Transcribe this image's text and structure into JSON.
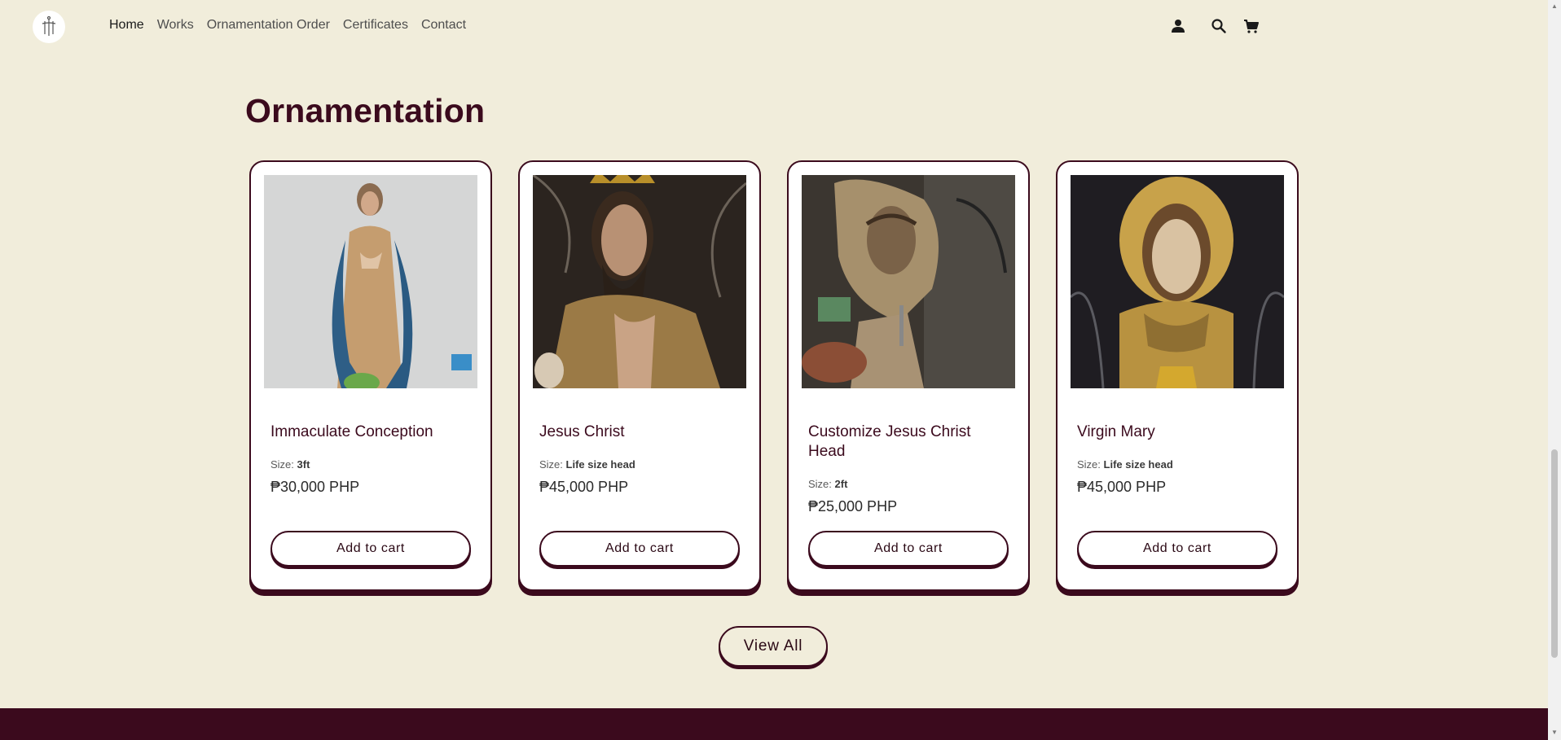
{
  "header": {
    "nav": [
      {
        "label": "Home",
        "active": true
      },
      {
        "label": "Works"
      },
      {
        "label": "Ornamentation Order"
      },
      {
        "label": "Certificates"
      },
      {
        "label": "Contact"
      }
    ],
    "icons": [
      "account-icon",
      "search-icon",
      "cart-icon"
    ]
  },
  "section": {
    "title": "Ornamentation",
    "view_all_label": "View All"
  },
  "products": [
    {
      "title": "Immaculate Conception",
      "size_label": "Size: ",
      "size_value": "3ft",
      "price": "₱30,000 PHP",
      "button": "Add to cart"
    },
    {
      "title": "Jesus Christ",
      "size_label": "Size: ",
      "size_value": "Life size head",
      "price": "₱45,000 PHP",
      "button": "Add to cart"
    },
    {
      "title": "Customize Jesus Christ Head",
      "size_label": "Size: ",
      "size_value": "2ft",
      "price": "₱25,000 PHP",
      "button": "Add to cart"
    },
    {
      "title": "Virgin Mary",
      "size_label": "Size: ",
      "size_value": "Life size head",
      "price": "₱45,000 PHP",
      "button": "Add to cart"
    }
  ],
  "colors": {
    "background": "#f1eddb",
    "brand": "#3b0a1d",
    "card": "#ffffff"
  }
}
